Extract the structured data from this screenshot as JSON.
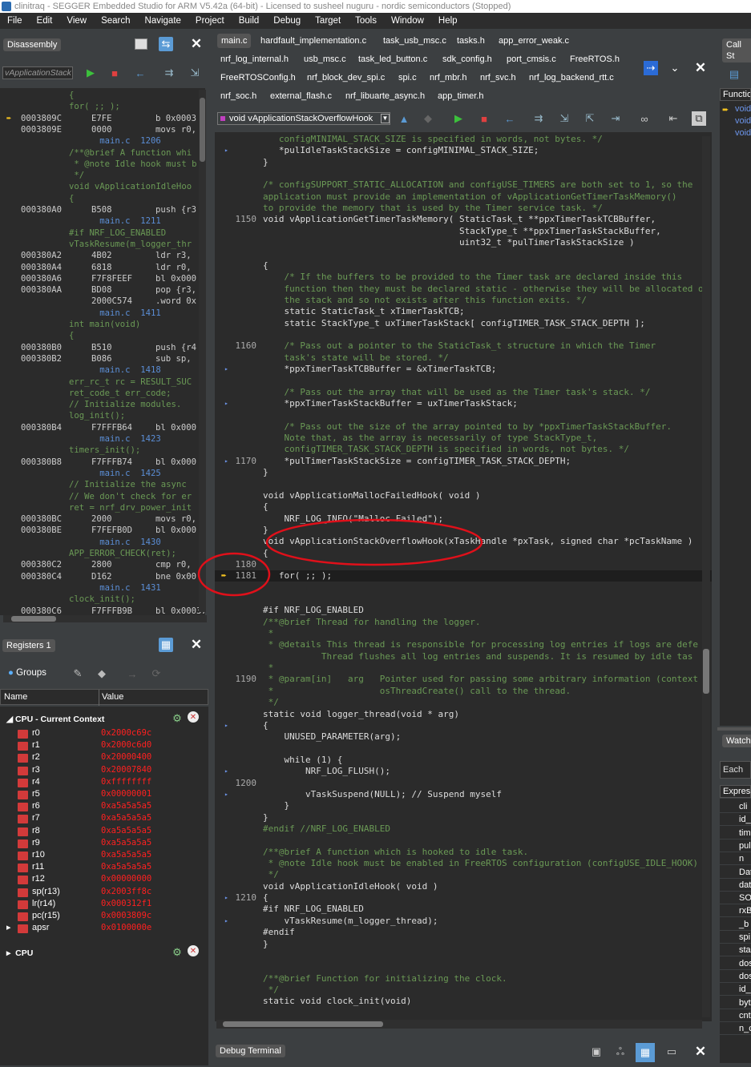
{
  "title": "clinitraq - SEGGER Embedded Studio for ARM V5.42a (64-bit) - Licensed to susheel nuguru - nordic semiconductors (Stopped)",
  "menu": [
    "File",
    "Edit",
    "View",
    "Search",
    "Navigate",
    "Project",
    "Build",
    "Debug",
    "Target",
    "Tools",
    "Window",
    "Help"
  ],
  "disassembly": {
    "tab": "Disassembly",
    "symbol": "vApplicationStack",
    "lines": [
      {
        "t": "{",
        "c": "code-c"
      },
      {
        "t": "for( ;; );",
        "c": "code-c"
      },
      {
        "a": "0003809C",
        "o": "E7FE",
        "i": "b 0x0003",
        "c": "addr",
        "cur": true
      },
      {
        "a": "0003809E",
        "o": "0000",
        "i": "movs r0,",
        "c": "addr"
      },
      {
        "t": "      main.c  1206",
        "c": "src-ref"
      },
      {
        "t": "/**@brief A function whi",
        "c": "code-c"
      },
      {
        "t": " * @note Idle hook must b",
        "c": "code-c"
      },
      {
        "t": " */",
        "c": "code-c"
      },
      {
        "t": "void vApplicationIdleHoo",
        "c": "code-c"
      },
      {
        "t": "{",
        "c": "code-c"
      },
      {
        "a": "000380A0",
        "o": "B508",
        "i": "push {r3",
        "c": "addr"
      },
      {
        "t": "      main.c  1211",
        "c": "src-ref"
      },
      {
        "t": "#if NRF_LOG_ENABLED",
        "c": "code-c"
      },
      {
        "t": "vTaskResume(m_logger_thr",
        "c": "code-c"
      },
      {
        "a": "000380A2",
        "o": "4B02",
        "i": "ldr r3,",
        "c": "addr"
      },
      {
        "a": "000380A4",
        "o": "6818",
        "i": "ldr r0,",
        "c": "addr"
      },
      {
        "a": "000380A6",
        "o": "F7F8FEEF",
        "i": "bl 0x000",
        "c": "addr"
      },
      {
        "a": "000380AA",
        "o": "BD08",
        "i": "pop {r3,",
        "c": "addr"
      },
      {
        "a": "",
        "o": "2000C574",
        "i": ".word 0x",
        "c": "addr"
      },
      {
        "t": "      main.c  1411",
        "c": "src-ref"
      },
      {
        "t": "int main(void)",
        "c": "code-c"
      },
      {
        "t": "{",
        "c": "code-c"
      },
      {
        "a": "000380B0",
        "o": "B510",
        "i": "push {r4",
        "c": "addr"
      },
      {
        "a": "000380B2",
        "o": "B086",
        "i": "sub sp,",
        "c": "addr"
      },
      {
        "t": "      main.c  1418",
        "c": "src-ref"
      },
      {
        "t": "err_rc_t rc = RESULT_SUC",
        "c": "code-c"
      },
      {
        "t": "ret_code_t err_code;",
        "c": "code-c"
      },
      {
        "t": "// Initialize modules.",
        "c": "code-c"
      },
      {
        "t": "log_init();",
        "c": "code-c"
      },
      {
        "a": "000380B4",
        "o": "F7FFFB64",
        "i": "bl 0x000",
        "c": "addr"
      },
      {
        "t": "      main.c  1423",
        "c": "src-ref"
      },
      {
        "t": "timers_init();",
        "c": "code-c"
      },
      {
        "a": "000380B8",
        "o": "F7FFFB74",
        "i": "bl 0x000",
        "c": "addr"
      },
      {
        "t": "      main.c  1425",
        "c": "src-ref"
      },
      {
        "t": "// Initialize the async",
        "c": "code-c"
      },
      {
        "t": "// We don't check for er",
        "c": "code-c"
      },
      {
        "t": "ret = nrf_drv_power_init",
        "c": "code-c"
      },
      {
        "a": "000380BC",
        "o": "2000",
        "i": "movs r0,",
        "c": "addr"
      },
      {
        "a": "000380BE",
        "o": "F7FEFB0D",
        "i": "bl 0x000",
        "c": "addr"
      },
      {
        "t": "      main.c  1430",
        "c": "src-ref"
      },
      {
        "t": "APP_ERROR_CHECK(ret);",
        "c": "code-c"
      },
      {
        "a": "000380C2",
        "o": "2800",
        "i": "cmp r0,",
        "c": "addr"
      },
      {
        "a": "000380C4",
        "o": "D162",
        "i": "bne 0x00",
        "c": "addr"
      },
      {
        "t": "      main.c  1431",
        "c": "src-ref"
      },
      {
        "t": "clock_init();",
        "c": "code-c"
      },
      {
        "a": "000380C6",
        "o": "F7FFFB9B",
        "i": "bl 0x00037",
        "c": "addr"
      }
    ]
  },
  "registers": {
    "tab": "Registers 1",
    "groups_label": "Groups",
    "col_name": "Name",
    "col_value": "Value",
    "group1": "CPU - Current Context",
    "group2": "CPU",
    "rows": [
      {
        "n": "r0",
        "v": "0x2000c69c"
      },
      {
        "n": "r1",
        "v": "0x2000c6d0"
      },
      {
        "n": "r2",
        "v": "0x20000400"
      },
      {
        "n": "r3",
        "v": "0x20007840"
      },
      {
        "n": "r4",
        "v": "0xffffffff"
      },
      {
        "n": "r5",
        "v": "0x00000001"
      },
      {
        "n": "r6",
        "v": "0xa5a5a5a5"
      },
      {
        "n": "r7",
        "v": "0xa5a5a5a5"
      },
      {
        "n": "r8",
        "v": "0xa5a5a5a5"
      },
      {
        "n": "r9",
        "v": "0xa5a5a5a5"
      },
      {
        "n": "r10",
        "v": "0xa5a5a5a5"
      },
      {
        "n": "r11",
        "v": "0xa5a5a5a5"
      },
      {
        "n": "r12",
        "v": "0x00000000"
      },
      {
        "n": "sp(r13)",
        "v": "0x2003ff8c"
      },
      {
        "n": "lr(r14)",
        "v": "0x000312f1"
      },
      {
        "n": "pc(r15)",
        "v": "0x0003809c"
      },
      {
        "n": "apsr",
        "v": "0x0100000e"
      }
    ]
  },
  "file_tabs": [
    [
      "main.c",
      "hardfault_implementation.c",
      "task_usb_msc.c",
      "tasks.h",
      "app_error_weak.c"
    ],
    [
      "nrf_log_internal.h",
      "usb_msc.c",
      "task_led_button.c",
      "sdk_config.h",
      "port_cmsis.c",
      "FreeRTOS.h"
    ],
    [
      "FreeRTOSConfig.h",
      "nrf_block_dev_spi.c",
      "spi.c",
      "nrf_mbr.h",
      "nrf_svc.h",
      "nrf_log_backend_rtt.c"
    ],
    [
      "nrf_soc.h",
      "external_flash.c",
      "nrf_libuarte_async.h",
      "app_timer.h"
    ]
  ],
  "function_selector": "void vApplicationStackOverflowHook",
  "editor_lines": [
    {
      "n": "",
      "t": "   configMINIMAL_STACK_SIZE is specified in words, not bytes. */",
      "c": "cm"
    },
    {
      "n": "",
      "t": "   *pulIdleTaskStackSize = configMINIMAL_STACK_SIZE;",
      "c": "fn",
      "m": true
    },
    {
      "n": "",
      "t": "}",
      "c": "fn"
    },
    {
      "n": "",
      "t": "",
      "c": "fn"
    },
    {
      "n": "",
      "t": "/* configSUPPORT_STATIC_ALLOCATION and configUSE_TIMERS are both set to 1, so the",
      "c": "cm"
    },
    {
      "n": "",
      "t": "application must provide an implementation of vApplicationGetTimerTaskMemory()",
      "c": "cm"
    },
    {
      "n": "",
      "t": "to provide the memory that is used by the Timer service task. */",
      "c": "cm"
    },
    {
      "n": "1150",
      "t": "void vApplicationGetTimerTaskMemory( StaticTask_t **ppxTimerTaskTCBBuffer,",
      "c": "fn"
    },
    {
      "n": "",
      "t": "                                     StackType_t **ppxTimerTaskStackBuffer,",
      "c": "fn"
    },
    {
      "n": "",
      "t": "                                     uint32_t *pulTimerTaskStackSize )",
      "c": "fn"
    },
    {
      "n": "",
      "t": "",
      "c": "fn"
    },
    {
      "n": "",
      "t": "{",
      "c": "fn"
    },
    {
      "n": "",
      "t": "    /* If the buffers to be provided to the Timer task are declared inside this",
      "c": "cm"
    },
    {
      "n": "",
      "t": "    function then they must be declared static - otherwise they will be allocated o",
      "c": "cm"
    },
    {
      "n": "",
      "t": "    the stack and so not exists after this function exits. */",
      "c": "cm"
    },
    {
      "n": "",
      "t": "    static StaticTask_t xTimerTaskTCB;",
      "c": "fn"
    },
    {
      "n": "",
      "t": "    static StackType_t uxTimerTaskStack[ configTIMER_TASK_STACK_DEPTH ];",
      "c": "fn"
    },
    {
      "n": "",
      "t": "",
      "c": "fn"
    },
    {
      "n": "1160",
      "t": "    /* Pass out a pointer to the StaticTask_t structure in which the Timer",
      "c": "cm"
    },
    {
      "n": "",
      "t": "    task's state will be stored. */",
      "c": "cm"
    },
    {
      "n": "",
      "t": "    *ppxTimerTaskTCBBuffer = &xTimerTaskTCB;",
      "c": "fn",
      "m": true
    },
    {
      "n": "",
      "t": "",
      "c": "fn"
    },
    {
      "n": "",
      "t": "    /* Pass out the array that will be used as the Timer task's stack. */",
      "c": "cm"
    },
    {
      "n": "",
      "t": "    *ppxTimerTaskStackBuffer = uxTimerTaskStack;",
      "c": "fn",
      "m": true
    },
    {
      "n": "",
      "t": "",
      "c": "fn"
    },
    {
      "n": "",
      "t": "    /* Pass out the size of the array pointed to by *ppxTimerTaskStackBuffer.",
      "c": "cm"
    },
    {
      "n": "",
      "t": "    Note that, as the array is necessarily of type StackType_t,",
      "c": "cm"
    },
    {
      "n": "",
      "t": "    configTIMER_TASK_STACK_DEPTH is specified in words, not bytes. */",
      "c": "cm"
    },
    {
      "n": "1170",
      "t": "    *pulTimerTaskStackSize = configTIMER_TASK_STACK_DEPTH;",
      "c": "fn",
      "m": true
    },
    {
      "n": "",
      "t": "}",
      "c": "fn"
    },
    {
      "n": "",
      "t": "",
      "c": "fn"
    },
    {
      "n": "",
      "t": "void vApplicationMallocFailedHook( void )",
      "c": "fn"
    },
    {
      "n": "",
      "t": "{",
      "c": "fn"
    },
    {
      "n": "",
      "t": "    NRF_LOG_INFO(\"Malloc Failed\");",
      "c": "fn"
    },
    {
      "n": "",
      "t": "}",
      "c": "fn"
    },
    {
      "n": "",
      "t": "void vApplicationStackOverflowHook(xTaskHandle *pxTask, signed char *pcTaskName )",
      "c": "fn"
    },
    {
      "n": "",
      "t": "{",
      "c": "fn"
    },
    {
      "n": "1180",
      "t": "",
      "c": "fn"
    },
    {
      "n": "1181",
      "t": "   for( ;; );",
      "c": "fn",
      "cur": true
    },
    {
      "n": "",
      "t": "",
      "c": "fn"
    },
    {
      "n": "",
      "t": "",
      "c": "fn"
    },
    {
      "n": "",
      "t": "#if NRF_LOG_ENABLED",
      "c": "fn"
    },
    {
      "n": "",
      "t": "/**@brief Thread for handling the logger.",
      "c": "cm"
    },
    {
      "n": "",
      "t": " *",
      "c": "cm"
    },
    {
      "n": "",
      "t": " * @details This thread is responsible for processing log entries if logs are defe",
      "c": "cm"
    },
    {
      "n": "",
      "t": "           Thread flushes all log entries and suspends. It is resumed by idle tas",
      "c": "cm"
    },
    {
      "n": "",
      "t": " *",
      "c": "cm"
    },
    {
      "n": "1190",
      "t": " * @param[in]   arg   Pointer used for passing some arbitrary information (context",
      "c": "cm"
    },
    {
      "n": "",
      "t": " *                    osThreadCreate() call to the thread.",
      "c": "cm"
    },
    {
      "n": "",
      "t": " */",
      "c": "cm"
    },
    {
      "n": "",
      "t": "static void logger_thread(void * arg)",
      "c": "fn"
    },
    {
      "n": "",
      "t": "{",
      "c": "fn",
      "m": true
    },
    {
      "n": "",
      "t": "    UNUSED_PARAMETER(arg);",
      "c": "fn"
    },
    {
      "n": "",
      "t": "",
      "c": "fn"
    },
    {
      "n": "",
      "t": "    while (1) {",
      "c": "fn"
    },
    {
      "n": "",
      "t": "        NRF_LOG_FLUSH();",
      "c": "fn",
      "m": true
    },
    {
      "n": "1200",
      "t": "",
      "c": "fn"
    },
    {
      "n": "",
      "t": "        vTaskSuspend(NULL); // Suspend myself",
      "c": "fn",
      "m": true
    },
    {
      "n": "",
      "t": "    }",
      "c": "fn"
    },
    {
      "n": "",
      "t": "}",
      "c": "fn"
    },
    {
      "n": "",
      "t": "#endif //NRF_LOG_ENABLED",
      "c": "cm"
    },
    {
      "n": "",
      "t": "",
      "c": "fn"
    },
    {
      "n": "",
      "t": "/**@brief A function which is hooked to idle task.",
      "c": "cm"
    },
    {
      "n": "",
      "t": " * @note Idle hook must be enabled in FreeRTOS configuration (configUSE_IDLE_HOOK)",
      "c": "cm"
    },
    {
      "n": "",
      "t": " */",
      "c": "cm"
    },
    {
      "n": "",
      "t": "void vApplicationIdleHook( void )",
      "c": "fn"
    },
    {
      "n": "1210",
      "t": "{",
      "c": "fn",
      "m": true
    },
    {
      "n": "",
      "t": "#if NRF_LOG_ENABLED",
      "c": "fn"
    },
    {
      "n": "",
      "t": "    vTaskResume(m_logger_thread);",
      "c": "fn",
      "m": true
    },
    {
      "n": "",
      "t": "#endif",
      "c": "fn"
    },
    {
      "n": "",
      "t": "}",
      "c": "fn"
    },
    {
      "n": "",
      "t": "",
      "c": "fn"
    },
    {
      "n": "",
      "t": "",
      "c": "fn"
    },
    {
      "n": "",
      "t": "/**@brief Function for initializing the clock.",
      "c": "cm"
    },
    {
      "n": "",
      "t": " */",
      "c": "cm"
    },
    {
      "n": "",
      "t": "static void clock_init(void)",
      "c": "fn"
    }
  ],
  "right": {
    "call_stack_tab": "Call St",
    "function_hdr": "Functio",
    "functions": [
      "void",
      "void",
      "void"
    ],
    "watch_tab": "Watch",
    "each_se": "Each Se",
    "expr_hdr": "Express",
    "watch_items": [
      "cli",
      "id_",
      "tim",
      "pul",
      "n",
      "Dat",
      "dat",
      "SOC",
      "rxB",
      "_b",
      "spi",
      "sta",
      "dos",
      "dos",
      "id_",
      "byt",
      "cnt",
      "n_c"
    ]
  },
  "debug_terminal": "Debug Terminal",
  "colors": {
    "annotation": "#e0101a",
    "register_value": "#ff2020"
  }
}
